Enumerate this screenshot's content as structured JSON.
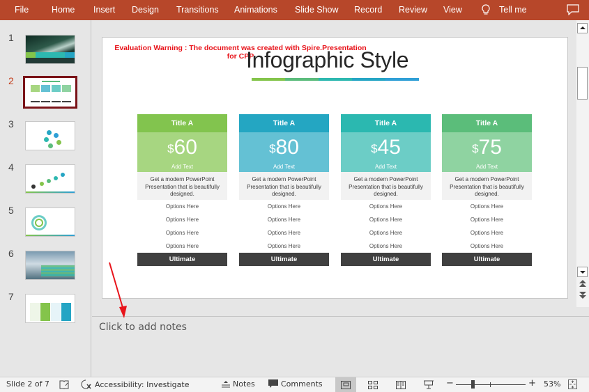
{
  "ribbon": {
    "tabs": [
      "File",
      "Home",
      "Insert",
      "Design",
      "Transitions",
      "Animations",
      "Slide Show",
      "Record",
      "Review",
      "View"
    ],
    "tell_me": "Tell me",
    "color": "#b7472a"
  },
  "thumbnails": {
    "items": [
      {
        "number": "1",
        "theme": "dark-green-hero"
      },
      {
        "number": "2",
        "theme": "pricing-table"
      },
      {
        "number": "3",
        "theme": "circle-infographic"
      },
      {
        "number": "4",
        "theme": "step-infographic"
      },
      {
        "number": "5",
        "theme": "ring-infographic"
      },
      {
        "number": "6",
        "theme": "city-photo"
      },
      {
        "number": "7",
        "theme": "column-table"
      }
    ],
    "active_index": 1,
    "active_color": "#7a1318"
  },
  "slide": {
    "warning_line1": "Evaluation Warning : The document was created with  Spire.Presentation",
    "warning_line2": "for CPP",
    "title": "Infographic Style",
    "underline_colors": [
      "#84c44b",
      "#5bbc7c",
      "#2db8b0",
      "#25a5c4",
      "#2f9fd6"
    ],
    "cards": [
      {
        "title": "Title A",
        "currency": "$",
        "price": "60",
        "add_text": "Add Text",
        "head_color": "#82c44e",
        "price_color": "#a7d681",
        "description": "Get a modern PowerPoint Presentation that is beautifully designed.",
        "options": [
          "Options Here",
          "Options Here",
          "Options Here",
          "Options Here"
        ],
        "button": "Ultimate"
      },
      {
        "title": "Title A",
        "currency": "$",
        "price": "80",
        "add_text": "Add Text",
        "head_color": "#24a6c2",
        "price_color": "#64c1d4",
        "description": "Get a modern PowerPoint Presentation that is beautifully designed.",
        "options": [
          "Options Here",
          "Options Here",
          "Options Here",
          "Options Here"
        ],
        "button": "Ultimate"
      },
      {
        "title": "Title A",
        "currency": "$",
        "price": "45",
        "add_text": "Add Text",
        "head_color": "#2bb8b0",
        "price_color": "#6ccdc6",
        "description": "Get a modern PowerPoint Presentation that is beautifully designed.",
        "options": [
          "Options Here",
          "Options Here",
          "Options Here",
          "Options Here"
        ],
        "button": "Ultimate"
      },
      {
        "title": "Title A",
        "currency": "$",
        "price": "75",
        "add_text": "Add Text",
        "head_color": "#5bbd7a",
        "price_color": "#8fd3a1",
        "description": "Get a modern PowerPoint Presentation that is beautifully designed.",
        "options": [
          "Options Here",
          "Options Here",
          "Options Here",
          "Options Here"
        ],
        "button": "Ultimate"
      }
    ]
  },
  "notes": {
    "placeholder": "Click to add notes"
  },
  "annotation": {
    "arrow_color": "#e8141b"
  },
  "status_bar": {
    "slide_info": "Slide 2 of 7",
    "accessibility": "Accessibility: Investigate",
    "notes": "Notes",
    "comments": "Comments",
    "zoom_level": "53%",
    "zoom_plus": "+",
    "zoom_minus": "−"
  }
}
